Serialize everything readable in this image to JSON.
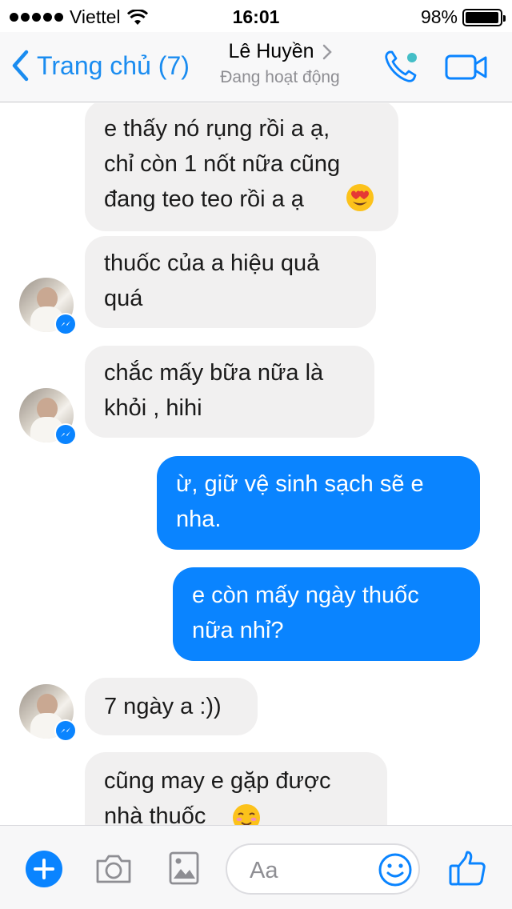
{
  "status_bar": {
    "carrier": "Viettel",
    "time": "16:01",
    "battery": "98%",
    "battery_level": 0.98
  },
  "nav": {
    "back_label": "Trang chủ (7)",
    "contact_name": "Lê Huyền",
    "contact_status": "Đang hoạt động"
  },
  "messages": [
    {
      "sender": "contact",
      "text": "e thấy nó rụng rồi a ạ,\nchỉ còn 1 nốt nữa cũng\nđang teo teo rồi a ạ"
    },
    {
      "sender": "contact",
      "text": "thuốc của a hiệu quả\nquá"
    },
    {
      "sender": "contact",
      "text": "chắc mấy bữa nữa là\nkhỏi , hihi"
    },
    {
      "sender": "me",
      "text": "ừ, giữ vệ sinh sạch sẽ e\nnha."
    },
    {
      "sender": "me",
      "text": "e còn mấy ngày thuốc\nnữa nhỉ?"
    },
    {
      "sender": "contact",
      "text": "7 ngày a :))"
    },
    {
      "sender": "contact",
      "text": "cũng may e gặp được\nnhà thuốc"
    }
  ],
  "composer": {
    "placeholder": "Aa"
  },
  "colors": {
    "accent": "#0a84ff",
    "incoming_bubble": "#f1f0f0",
    "outgoing_bubble": "#0a84ff",
    "online": "#44bec7"
  },
  "icons": {
    "back": "chevron-left-icon",
    "contact_chevron": "chevron-right-icon",
    "call": "phone-icon",
    "video": "video-camera-icon",
    "plus": "plus-icon",
    "camera": "camera-icon",
    "gallery": "photo-icon",
    "emoji": "smiley-icon",
    "like": "thumbs-up-icon",
    "messenger_badge": "messenger-icon"
  }
}
